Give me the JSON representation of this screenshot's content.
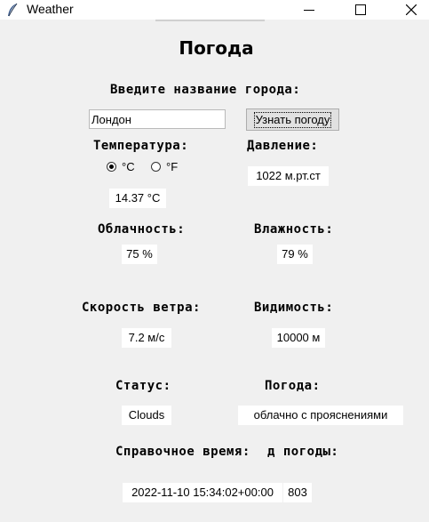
{
  "window": {
    "title": "Weather",
    "icon": "feather-icon"
  },
  "app": {
    "heading": "Погода",
    "city_prompt": "Введите название города:",
    "city_value": "Лондон",
    "fetch_button": "Узнать погоду",
    "labels": {
      "temperature": "Температура:",
      "pressure": "Давление:",
      "cloudiness": "Облачность:",
      "humidity": "Влажность:",
      "wind_speed": "Скорость ветра:",
      "visibility": "Видимость:",
      "status": "Статус:",
      "weather": "Погода:",
      "ref_time": "Справочное время:",
      "code": "д погоды:"
    },
    "units": {
      "celsius": "°C",
      "fahrenheit": "°F",
      "selected": "°C"
    },
    "values": {
      "temperature": "14.37 °C",
      "pressure": "1022 м.рт.ст",
      "cloudiness": "75 %",
      "humidity": "79 %",
      "wind_speed": "7.2 м/с",
      "visibility": "10000 м",
      "status": "Clouds",
      "weather": "облачно с прояснениями",
      "ref_time": "2022-11-10 15:34:02+00:00",
      "code": "803"
    }
  }
}
